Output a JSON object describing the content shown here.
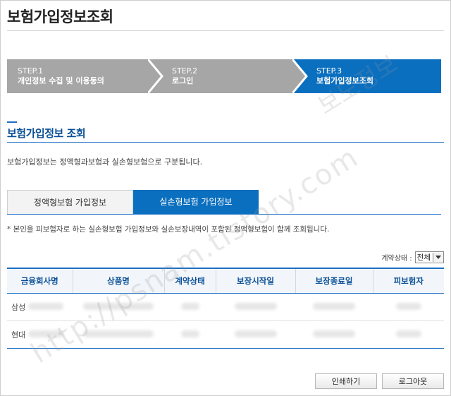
{
  "page": {
    "title": "보험가입정보조회"
  },
  "steps": [
    {
      "num": "STEP.1",
      "label": "개인정보 수집 및 이용동의",
      "active": false
    },
    {
      "num": "STEP.2",
      "label": "로그인",
      "active": false
    },
    {
      "num": "STEP.3",
      "label": "보험가입정보조회",
      "active": true
    }
  ],
  "section": {
    "title": "보험가입정보 조회",
    "description": "보험가입정보는 정액형과보험과 실손형보험으로 구분됩니다."
  },
  "tabs": [
    {
      "label": "정액형보험 가입정보",
      "active": false
    },
    {
      "label": "실손형보험 가입정보",
      "active": true
    }
  ],
  "note": "* 본인을 피보험자로 하는 실손형보험 가입정보와 실손보장내역이 포함된 정액형보험이 함께 조회됩니다.",
  "filter": {
    "label": "계약상태 :",
    "selected": "전체"
  },
  "table": {
    "headers": [
      "금융회사명",
      "상품명",
      "계약상태",
      "보장시작일",
      "보장종료일",
      "피보험자"
    ],
    "rows": [
      {
        "company": "삼성"
      },
      {
        "company": "현대"
      }
    ]
  },
  "buttons": {
    "print": "인쇄하기",
    "logout": "로그아웃"
  },
  "watermark": {
    "top": "보도정보",
    "diagonal": "http://psnam.tistory.com"
  },
  "colors": {
    "accent": "#0b6fbf",
    "step_inactive": "#a6a6a6",
    "title_blue": "#0a4f96"
  }
}
